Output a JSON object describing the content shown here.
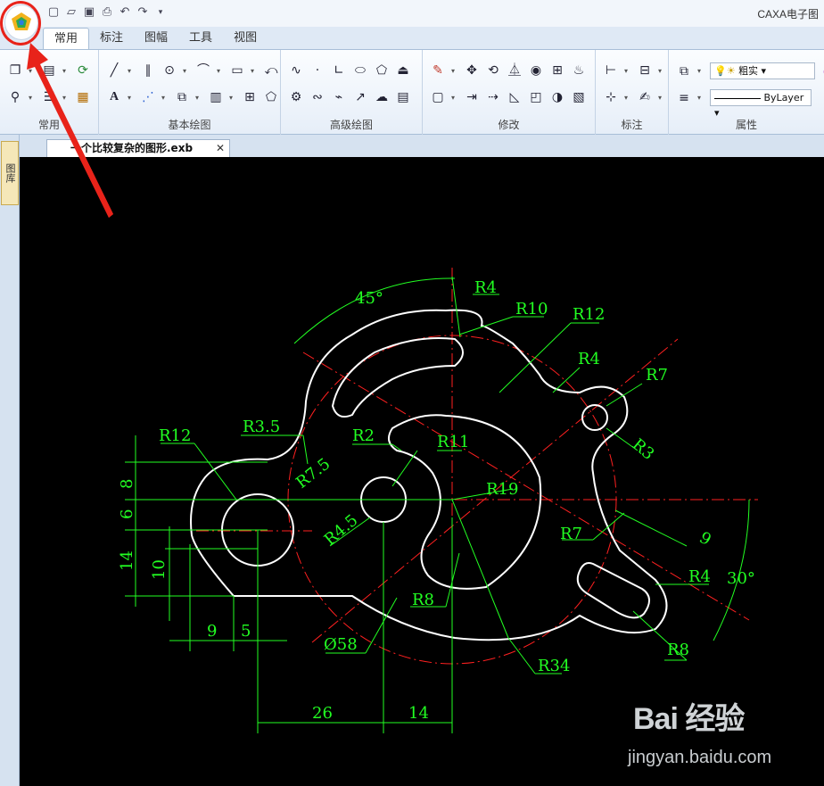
{
  "window": {
    "title": "CAXA电子图"
  },
  "quick_access": [
    "new-file-icon",
    "open-file-icon",
    "save-icon",
    "print-icon",
    "undo-icon",
    "redo-icon",
    "customize-icon"
  ],
  "tabs": [
    {
      "label": "常用"
    },
    {
      "label": "标注"
    },
    {
      "label": "图幅"
    },
    {
      "label": "工具"
    },
    {
      "label": "视图"
    }
  ],
  "ribbon": {
    "groups": [
      {
        "label": "常用"
      },
      {
        "label": "基本绘图"
      },
      {
        "label": "高级绘图"
      },
      {
        "label": "修改"
      },
      {
        "label": "标注"
      },
      {
        "label": "属性"
      }
    ],
    "properties": {
      "line_weight": "粗实",
      "line_type": "ByLayer"
    }
  },
  "side_panel": {
    "label": "图库"
  },
  "document": {
    "tab_label": "一个比较复杂的图形.exb"
  },
  "drawing": {
    "colors": {
      "background": "#000000",
      "outline": "#ffffff",
      "dimension": "#00ff00",
      "center": "#ff0000"
    },
    "dimensions": [
      "45°",
      "R4",
      "R10",
      "R12",
      "R4",
      "R7",
      "R3",
      "R12",
      "R3.5",
      "R2",
      "R11",
      "R7.5",
      "R19",
      "R4.5",
      "R7",
      "9",
      "R4",
      "30°",
      "R8",
      "R8",
      "Ø58",
      "R34",
      "26",
      "14",
      "9",
      "5",
      "8",
      "6",
      "14",
      "10"
    ]
  },
  "annotation": {
    "arrow_color": "#e8231a"
  },
  "watermark": {
    "brand": "Bai 经验",
    "url": "jingyan.baidu.com"
  }
}
